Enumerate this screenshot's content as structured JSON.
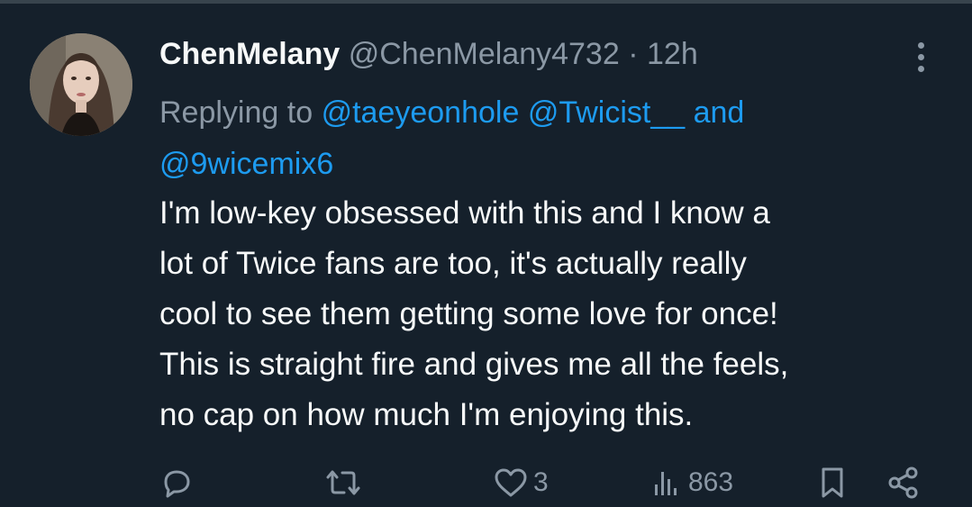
{
  "tweet": {
    "display_name": "ChenMelany",
    "handle": "@ChenMelany4732",
    "separator": "·",
    "time": "12h",
    "replying_prefix": "Replying to",
    "mentions": [
      "@taeyeonhole",
      "@Twicist__",
      "and",
      "@9wicemix6"
    ],
    "body_lines": [
      "I'm low-key obsessed with this and I know a",
      "lot of Twice fans are too, it's actually really",
      "cool to see them getting some love for once!",
      "This is straight fire and gives me all the feels,",
      "no cap on how much I'm enjoying this."
    ]
  },
  "actions": {
    "reply": {
      "icon": "reply-icon"
    },
    "retweet": {
      "icon": "retweet-icon"
    },
    "like": {
      "icon": "heart-icon",
      "count": "3"
    },
    "views": {
      "icon": "views-icon",
      "count": "863"
    },
    "bookmark": {
      "icon": "bookmark-icon"
    },
    "share": {
      "icon": "share-icon"
    }
  },
  "colors": {
    "background": "#15202b",
    "primary_text": "#f7f9f9",
    "secondary_text": "#8b98a5",
    "link": "#1d9bf0",
    "divider": "#38444d"
  }
}
